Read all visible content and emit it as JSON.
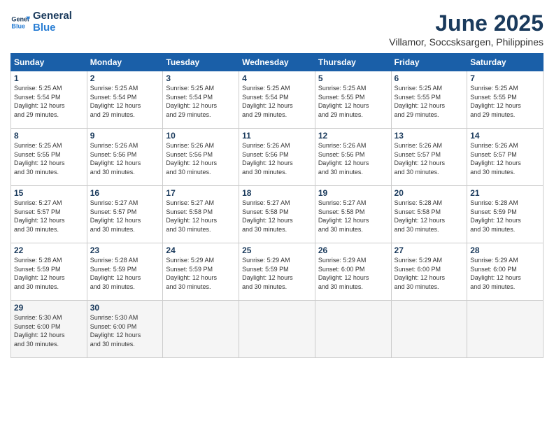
{
  "header": {
    "logo_line1": "General",
    "logo_line2": "Blue",
    "title": "June 2025",
    "location": "Villamor, Soccsksargen, Philippines"
  },
  "weekdays": [
    "Sunday",
    "Monday",
    "Tuesday",
    "Wednesday",
    "Thursday",
    "Friday",
    "Saturday"
  ],
  "weeks": [
    [
      {
        "day": "1",
        "info": "Sunrise: 5:25 AM\nSunset: 5:54 PM\nDaylight: 12 hours\nand 29 minutes."
      },
      {
        "day": "2",
        "info": "Sunrise: 5:25 AM\nSunset: 5:54 PM\nDaylight: 12 hours\nand 29 minutes."
      },
      {
        "day": "3",
        "info": "Sunrise: 5:25 AM\nSunset: 5:54 PM\nDaylight: 12 hours\nand 29 minutes."
      },
      {
        "day": "4",
        "info": "Sunrise: 5:25 AM\nSunset: 5:54 PM\nDaylight: 12 hours\nand 29 minutes."
      },
      {
        "day": "5",
        "info": "Sunrise: 5:25 AM\nSunset: 5:55 PM\nDaylight: 12 hours\nand 29 minutes."
      },
      {
        "day": "6",
        "info": "Sunrise: 5:25 AM\nSunset: 5:55 PM\nDaylight: 12 hours\nand 29 minutes."
      },
      {
        "day": "7",
        "info": "Sunrise: 5:25 AM\nSunset: 5:55 PM\nDaylight: 12 hours\nand 29 minutes."
      }
    ],
    [
      {
        "day": "8",
        "info": "Sunrise: 5:25 AM\nSunset: 5:55 PM\nDaylight: 12 hours\nand 30 minutes."
      },
      {
        "day": "9",
        "info": "Sunrise: 5:26 AM\nSunset: 5:56 PM\nDaylight: 12 hours\nand 30 minutes."
      },
      {
        "day": "10",
        "info": "Sunrise: 5:26 AM\nSunset: 5:56 PM\nDaylight: 12 hours\nand 30 minutes."
      },
      {
        "day": "11",
        "info": "Sunrise: 5:26 AM\nSunset: 5:56 PM\nDaylight: 12 hours\nand 30 minutes."
      },
      {
        "day": "12",
        "info": "Sunrise: 5:26 AM\nSunset: 5:56 PM\nDaylight: 12 hours\nand 30 minutes."
      },
      {
        "day": "13",
        "info": "Sunrise: 5:26 AM\nSunset: 5:57 PM\nDaylight: 12 hours\nand 30 minutes."
      },
      {
        "day": "14",
        "info": "Sunrise: 5:26 AM\nSunset: 5:57 PM\nDaylight: 12 hours\nand 30 minutes."
      }
    ],
    [
      {
        "day": "15",
        "info": "Sunrise: 5:27 AM\nSunset: 5:57 PM\nDaylight: 12 hours\nand 30 minutes."
      },
      {
        "day": "16",
        "info": "Sunrise: 5:27 AM\nSunset: 5:57 PM\nDaylight: 12 hours\nand 30 minutes."
      },
      {
        "day": "17",
        "info": "Sunrise: 5:27 AM\nSunset: 5:58 PM\nDaylight: 12 hours\nand 30 minutes."
      },
      {
        "day": "18",
        "info": "Sunrise: 5:27 AM\nSunset: 5:58 PM\nDaylight: 12 hours\nand 30 minutes."
      },
      {
        "day": "19",
        "info": "Sunrise: 5:27 AM\nSunset: 5:58 PM\nDaylight: 12 hours\nand 30 minutes."
      },
      {
        "day": "20",
        "info": "Sunrise: 5:28 AM\nSunset: 5:58 PM\nDaylight: 12 hours\nand 30 minutes."
      },
      {
        "day": "21",
        "info": "Sunrise: 5:28 AM\nSunset: 5:59 PM\nDaylight: 12 hours\nand 30 minutes."
      }
    ],
    [
      {
        "day": "22",
        "info": "Sunrise: 5:28 AM\nSunset: 5:59 PM\nDaylight: 12 hours\nand 30 minutes."
      },
      {
        "day": "23",
        "info": "Sunrise: 5:28 AM\nSunset: 5:59 PM\nDaylight: 12 hours\nand 30 minutes."
      },
      {
        "day": "24",
        "info": "Sunrise: 5:29 AM\nSunset: 5:59 PM\nDaylight: 12 hours\nand 30 minutes."
      },
      {
        "day": "25",
        "info": "Sunrise: 5:29 AM\nSunset: 5:59 PM\nDaylight: 12 hours\nand 30 minutes."
      },
      {
        "day": "26",
        "info": "Sunrise: 5:29 AM\nSunset: 6:00 PM\nDaylight: 12 hours\nand 30 minutes."
      },
      {
        "day": "27",
        "info": "Sunrise: 5:29 AM\nSunset: 6:00 PM\nDaylight: 12 hours\nand 30 minutes."
      },
      {
        "day": "28",
        "info": "Sunrise: 5:29 AM\nSunset: 6:00 PM\nDaylight: 12 hours\nand 30 minutes."
      }
    ],
    [
      {
        "day": "29",
        "info": "Sunrise: 5:30 AM\nSunset: 6:00 PM\nDaylight: 12 hours\nand 30 minutes."
      },
      {
        "day": "30",
        "info": "Sunrise: 5:30 AM\nSunset: 6:00 PM\nDaylight: 12 hours\nand 30 minutes."
      },
      {
        "day": "",
        "info": ""
      },
      {
        "day": "",
        "info": ""
      },
      {
        "day": "",
        "info": ""
      },
      {
        "day": "",
        "info": ""
      },
      {
        "day": "",
        "info": ""
      }
    ]
  ]
}
